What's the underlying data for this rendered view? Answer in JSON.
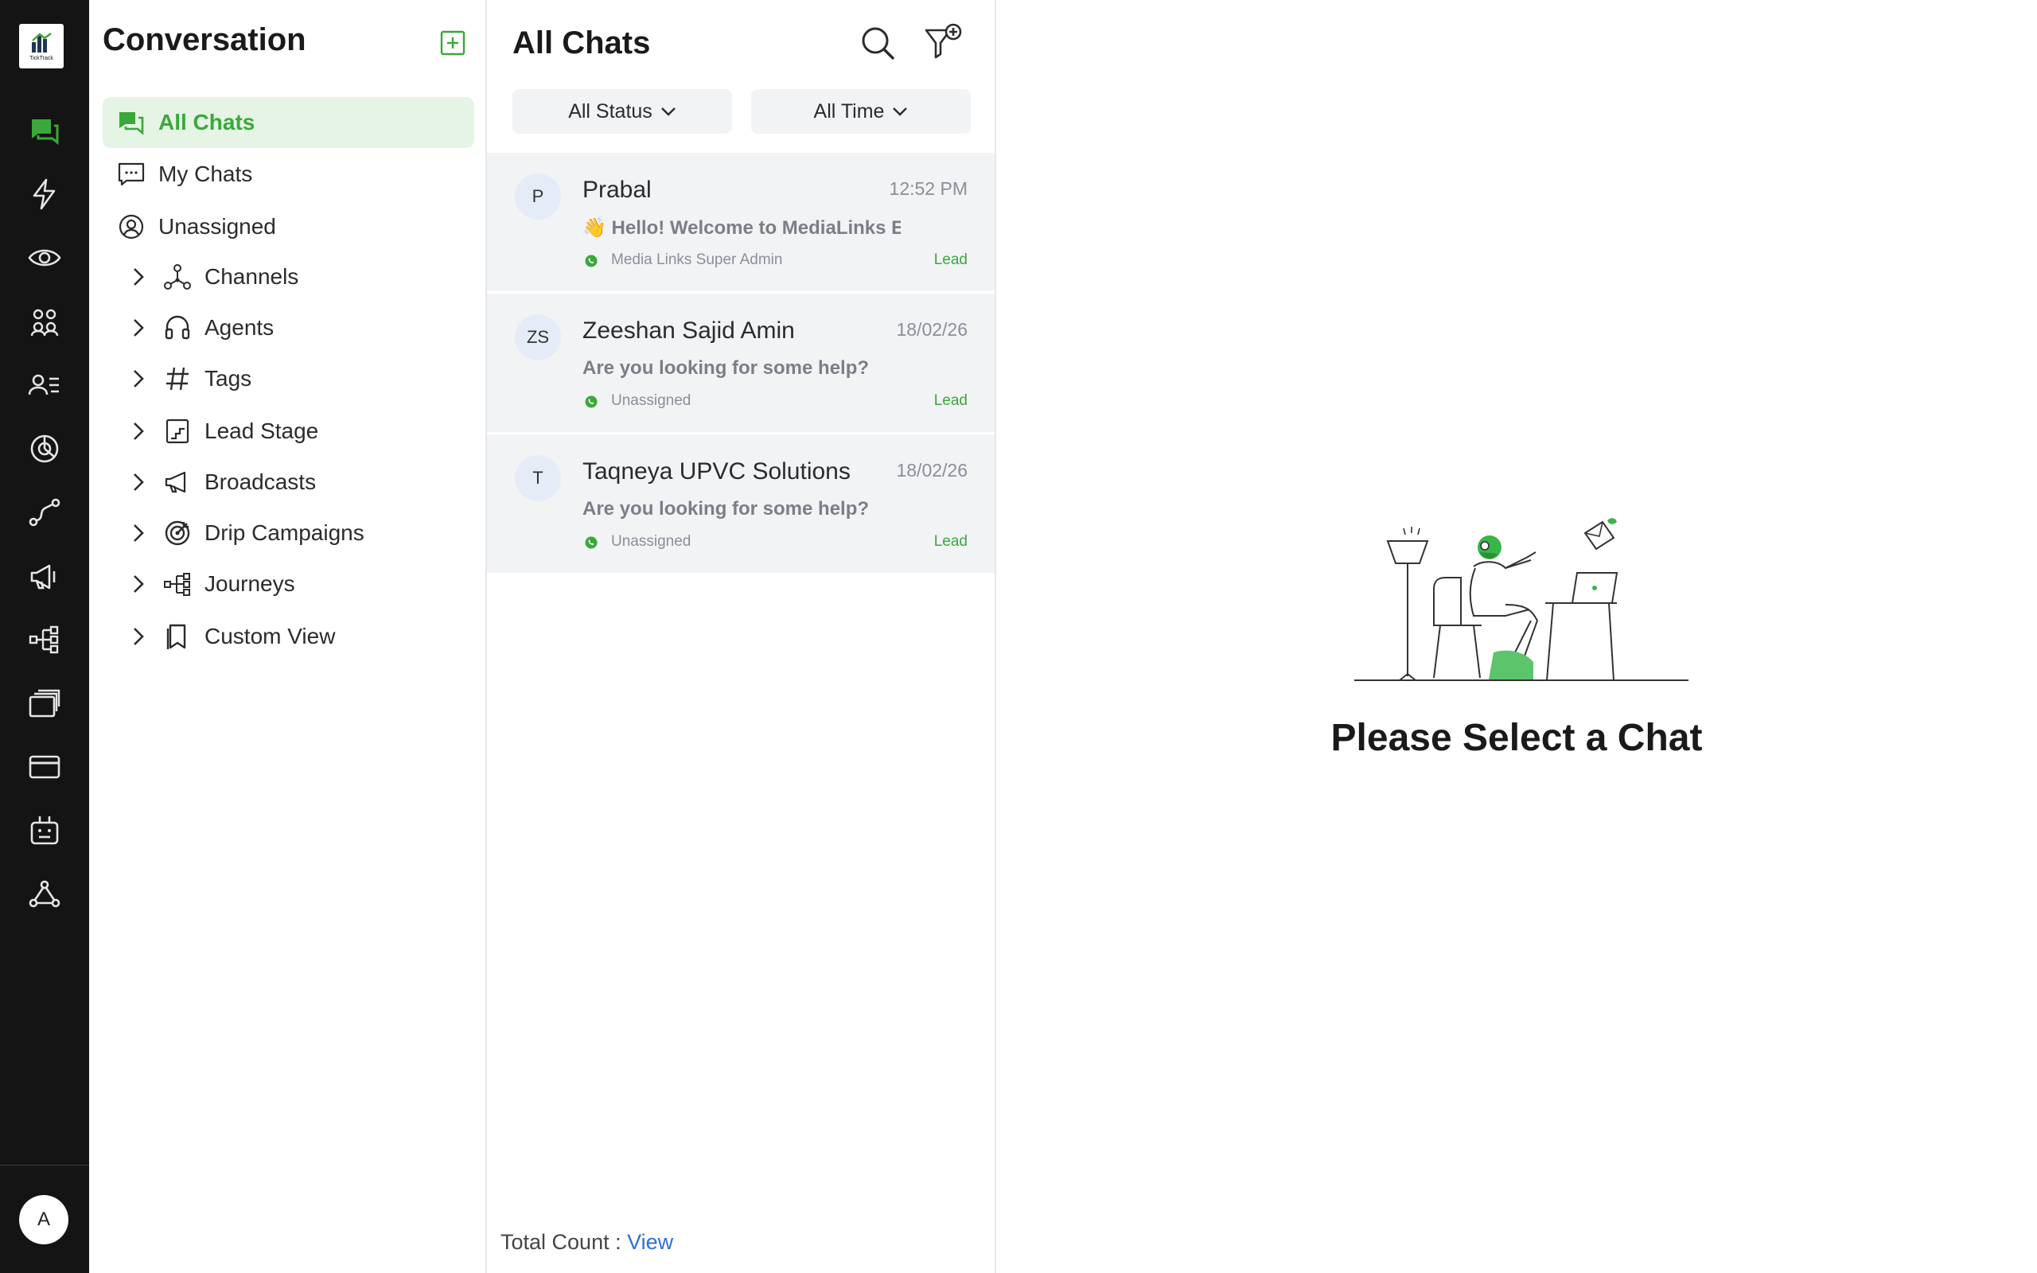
{
  "brand": {
    "logo_text": "TickTrack",
    "accent": "#3aa83a"
  },
  "rail": {
    "icons": [
      "chat-icon",
      "lightning-icon",
      "eye-icon",
      "users-icon",
      "contacts-list-icon",
      "analytics-icon",
      "route-icon",
      "megaphone-icon",
      "flow-icon",
      "cards-icon",
      "billing-icon",
      "bot-icon",
      "webhook-icon"
    ],
    "avatar_initial": "A"
  },
  "conversation": {
    "title": "Conversation",
    "items": [
      {
        "label": "All Chats",
        "icon": "chat-bubbles-icon",
        "active": true
      },
      {
        "label": "My Chats",
        "icon": "message-icon",
        "active": false
      },
      {
        "label": "Unassigned",
        "icon": "user-search-icon",
        "active": false
      }
    ],
    "groups": [
      {
        "label": "Channels",
        "icon": "channels-icon"
      },
      {
        "label": "Agents",
        "icon": "headset-icon"
      },
      {
        "label": "Tags",
        "icon": "hashtag-icon"
      },
      {
        "label": "Lead Stage",
        "icon": "stairs-icon"
      },
      {
        "label": "Broadcasts",
        "icon": "megaphone-icon"
      },
      {
        "label": "Drip Campaigns",
        "icon": "target-icon"
      },
      {
        "label": "Journeys",
        "icon": "journey-icon"
      },
      {
        "label": "Custom View",
        "icon": "bookmark-icon"
      }
    ]
  },
  "chat_list": {
    "title": "All Chats",
    "status_filter": "All Status",
    "time_filter": "All Time",
    "chats": [
      {
        "initials": "P",
        "name": "Prabal",
        "time": "12:52 PM",
        "message": "👋 Hello! Welcome to MediaLinks Ev",
        "agent": "Media Links Super Admin",
        "stage": "Lead"
      },
      {
        "initials": "ZS",
        "name": "Zeeshan Sajid Amin",
        "time": "18/02/26",
        "message": "Are you looking for some help?",
        "agent": "Unassigned",
        "stage": "Lead"
      },
      {
        "initials": "T",
        "name": "Taqneya UPVC Solutions",
        "time": "18/02/26",
        "message": "Are you looking for some help?",
        "agent": "Unassigned",
        "stage": "Lead"
      }
    ],
    "footer_label": "Total Count :",
    "footer_link": "View"
  },
  "empty_state": {
    "message": "Please Select a Chat"
  }
}
